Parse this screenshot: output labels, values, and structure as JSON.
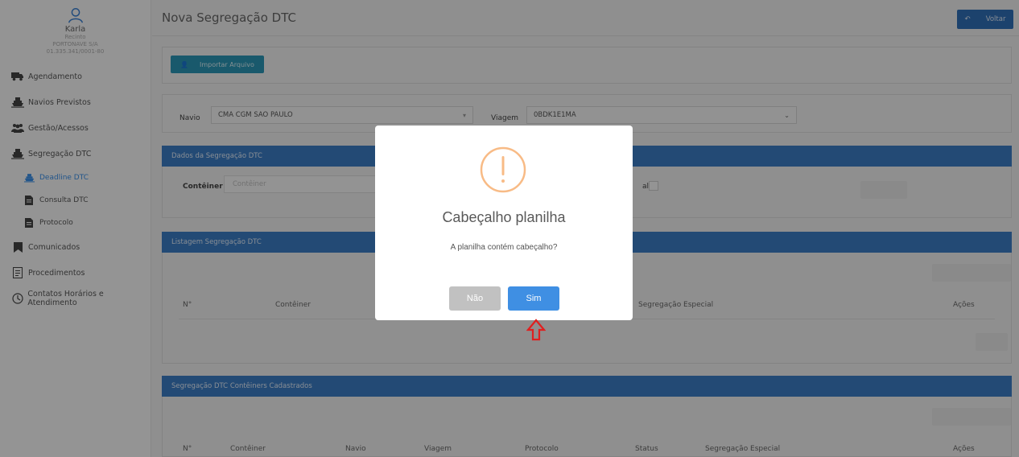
{
  "sidebar": {
    "user_name": "Karla",
    "role": "Recinto",
    "company": "PORTONAVE S/A",
    "cnpj": "01.335.341/0001-80",
    "items": [
      {
        "label": "Agendamento",
        "icon": "truck-icon"
      },
      {
        "label": "Navios Previstos",
        "icon": "ship-icon"
      },
      {
        "label": "Gestão/Acessos",
        "icon": "users-icon"
      },
      {
        "label": "Segregação DTC",
        "icon": "ship-icon"
      },
      {
        "label": "Deadline DTC",
        "icon": "ship-icon"
      },
      {
        "label": "Consulta DTC",
        "icon": "file-icon"
      },
      {
        "label": "Protocolo",
        "icon": "file-icon"
      },
      {
        "label": "Comunicados",
        "icon": "bookmark-icon"
      },
      {
        "label": "Procedimentos",
        "icon": "document-icon"
      },
      {
        "label": "Contatos Horários e Atendimento",
        "icon": "clock-icon"
      }
    ]
  },
  "header": {
    "title": "Nova Segregação DTC",
    "back_label": "Voltar"
  },
  "import": {
    "label": "Importar Arquivo"
  },
  "filters": {
    "navio_label": "Navio",
    "navio_value": "CMA CGM SAO PAULO",
    "viagem_label": "Viagem",
    "viagem_value": "0BDK1E1MA"
  },
  "dados": {
    "title": "Dados da Segregação DTC",
    "conteiner_label": "Contêiner",
    "conteiner_placeholder": "Contêiner",
    "especial_fragment": "al"
  },
  "listagem": {
    "title": "Listagem Segregação DTC",
    "columns": [
      "N°",
      "Contêiner",
      "Segregação Especial",
      "Ações"
    ]
  },
  "cadastrados": {
    "title": "Segregação DTC Contêiners Cadastrados",
    "columns": [
      "N°",
      "Contêiner",
      "Navio",
      "Viagem",
      "Protocolo",
      "Status",
      "Segregação Especial",
      "Ações"
    ]
  },
  "modal": {
    "title": "Cabeçalho planilha",
    "text": "A planilha contém cabeçalho?",
    "no_label": "Não",
    "yes_label": "Sim",
    "icon": "warning-icon"
  },
  "colors": {
    "accent": "#3f8fe3",
    "section_header": "#3b7cc4",
    "import_button": "#2b95b4",
    "warning": "#f8bb86",
    "arrow": "#e02020"
  }
}
